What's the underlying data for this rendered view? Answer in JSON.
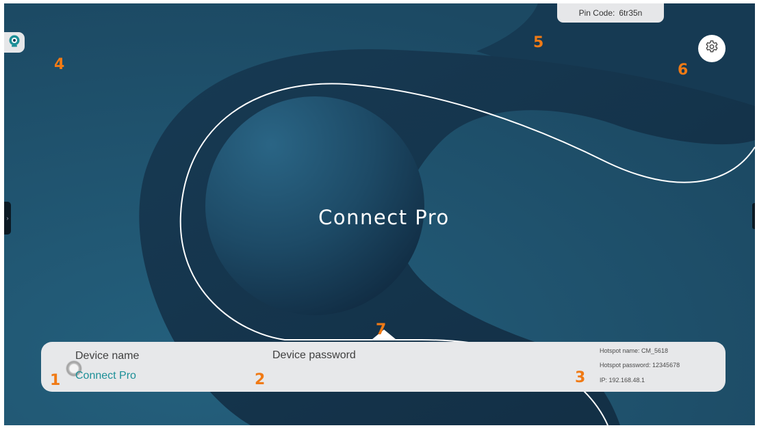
{
  "app": {
    "title": "Connect Pro"
  },
  "pin": {
    "label": "Pin Code:",
    "value": "6tr35n"
  },
  "panel": {
    "device_name_label": "Device name",
    "device_name_value": "Connect Pro",
    "device_password_label": "Device password",
    "hotspot_name": "Hotspot name: CM_5618",
    "hotspot_password": "Hotspot password: 12345678",
    "ip": "IP: 192.168.48.1"
  },
  "annotations": [
    "1",
    "2",
    "3",
    "4",
    "5",
    "6",
    "7"
  ],
  "icons": {
    "camera": "camera-icon",
    "settings": "gear-icon",
    "left_handle": "chevron-right-icon",
    "up_arrow": "up-arrow-icon"
  },
  "colors": {
    "background": "#1e506b",
    "accent_text": "#1c8f97",
    "annotation": "#f07a15",
    "panel": "#e7e8ea"
  }
}
